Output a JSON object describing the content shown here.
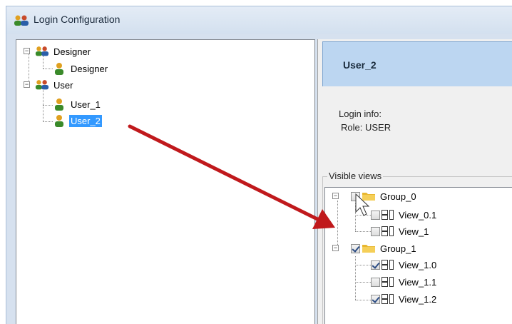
{
  "window": {
    "title": "Login Configuration"
  },
  "users_tree": {
    "groups": [
      {
        "label": "Designer",
        "children": [
          {
            "label": "Designer"
          }
        ]
      },
      {
        "label": "User",
        "children": [
          {
            "label": "User_1"
          },
          {
            "label": "User_2",
            "selected": true
          }
        ]
      }
    ]
  },
  "detail": {
    "header_name": "User_2",
    "login_info_label": "Login info:",
    "role_label": "Role: USER"
  },
  "visible_views": {
    "legend": "Visible views",
    "groups": [
      {
        "label": "Group_0",
        "checked": false,
        "views": [
          {
            "label": "View_0.1",
            "checked": false
          },
          {
            "label": "View_1",
            "checked": false
          }
        ]
      },
      {
        "label": "Group_1",
        "checked": true,
        "views": [
          {
            "label": "View_1.0",
            "checked": true
          },
          {
            "label": "View_1.1",
            "checked": false
          },
          {
            "label": "View_1.2",
            "checked": true
          }
        ]
      }
    ]
  },
  "colors": {
    "selection": "#3399ff",
    "header": "#bcd6f1",
    "arrow": "#c0191c"
  }
}
